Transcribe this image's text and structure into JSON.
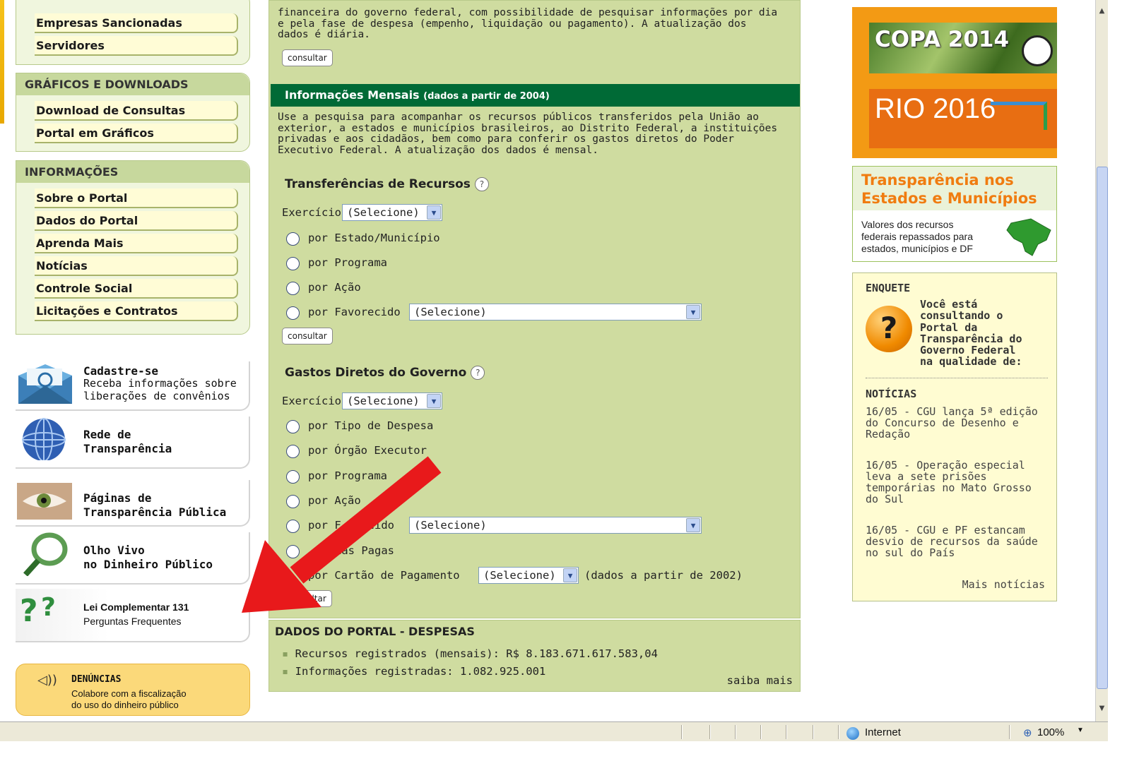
{
  "left": {
    "top_items": [
      "Empresas Sancionadas",
      "Servidores"
    ],
    "graficos": {
      "title": "GRÁFICOS E DOWNLOADS",
      "items": [
        "Download de Consultas",
        "Portal em Gráficos"
      ]
    },
    "informacoes": {
      "title": "INFORMAÇÕES",
      "items": [
        "Sobre o Portal",
        "Dados do Portal",
        "Aprenda Mais",
        "Notícias",
        "Controle Social",
        "Licitações e Contratos"
      ]
    },
    "promos": [
      {
        "title": "Cadastre-se",
        "line1": "Receba informações sobre",
        "line2": "liberações de convênios"
      },
      {
        "title": "Rede de",
        "title2": "Transparência"
      },
      {
        "title": "Páginas de",
        "title2": "Transparência Pública"
      },
      {
        "title": "Olho Vivo",
        "title2": "no Dinheiro Público"
      },
      {
        "title": "Lei Complementar 131",
        "line1": "Perguntas Frequentes"
      }
    ],
    "denuncias": {
      "title": "DENÚNCIAS",
      "line1": "Colabore com a fiscalização",
      "line2": "do uso do dinheiro público"
    }
  },
  "center": {
    "intro_lines": [
      "financeira do governo federal, com possibilidade de pesquisar informações por dia",
      "e pela fase de despesa (empenho, liquidação ou pagamento). A atualização dos",
      "dados é diária."
    ],
    "consult_label": "consultar",
    "mensais": {
      "title": "Informações Mensais",
      "subtitle": "(dados a partir de 2004)",
      "desc_lines": [
        "Use a pesquisa para acompanhar os recursos públicos transferidos pela União ao",
        "exterior, a estados e municípios brasileiros, ao Distrito Federal, a instituições",
        "privadas e aos cidadãos, bem como para conferir os gastos diretos do Poder",
        "Executivo Federal. A atualização dos dados é mensal."
      ]
    },
    "transferencias": {
      "title": "Transferências de Recursos",
      "exercicio_label": "Exercício",
      "exercicio_value": "(Selecione)",
      "options": [
        "por Estado/Município",
        "por Programa",
        "por Ação",
        "por Favorecido"
      ],
      "favorecido_value": "(Selecione)"
    },
    "gastos": {
      "title": "Gastos Diretos do Governo",
      "exercicio_label": "Exercício",
      "exercicio_value": "(Selecione)",
      "options": [
        "por Tipo de Despesa",
        "por Órgão Executor",
        "por Programa",
        "por Ação",
        "por Favorecido",
        "Diárias Pagas",
        "por Cartão de Pagamento"
      ],
      "favorecido_visible": "por F",
      "favorecido_tail": "recido",
      "diarias_visible": "ias Pagas",
      "favorecido_value": "(Selecione)",
      "cartao_value": "(Selecione)",
      "cartao_note": "(dados a partir de 2002)",
      "consult_visible": "nsultar"
    },
    "dados": {
      "title": "DADOS DO PORTAL - DESPESAS",
      "line1": "Recursos registrados (mensais): R$ 8.183.671.617.583,04",
      "line2": "Informações registradas: 1.082.925.001",
      "more": "saiba mais"
    }
  },
  "right": {
    "copa": "COPA 2014",
    "rio": "RIO 2016",
    "estados": {
      "title1": "Transparência nos",
      "title2": "Estados e Municípios",
      "lines": [
        "Valores dos recursos",
        "federais repassados para",
        "estados, municípios e DF"
      ]
    },
    "enquete": {
      "title": "ENQUETE",
      "lines": [
        "Você está",
        "consultando o",
        "Portal da",
        "Transparência do",
        "Governo Federal",
        "na qualidade de:"
      ]
    },
    "noticias": {
      "title": "NOTÍCIAS",
      "items": [
        [
          "16/05 - CGU lança 5ª edição",
          "do Concurso de Desenho e",
          "Redação"
        ],
        [
          "16/05 - Operação especial",
          "leva a sete prisões",
          "temporárias no Mato Grosso",
          "do Sul"
        ],
        [
          "16/05 - CGU e PF estancam",
          "desvio de recursos da saúde",
          "no sul do País"
        ]
      ],
      "more": "Mais notícias"
    }
  },
  "status": {
    "zone": "Internet",
    "zoom": "100%"
  },
  "colors": {
    "green_bar": "#006a36",
    "panel": "#cfdca0",
    "orange": "#f39a14",
    "arrow": "#e8191b"
  }
}
